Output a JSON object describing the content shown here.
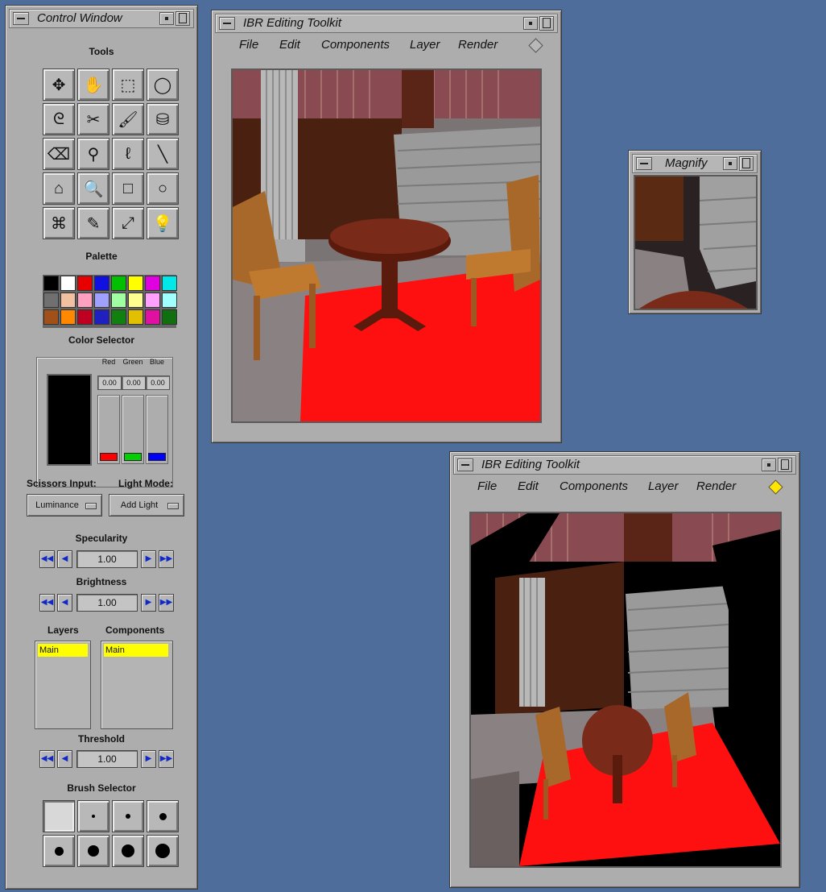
{
  "control_window": {
    "title": "Control Window",
    "sections": {
      "tools": "Tools",
      "palette": "Palette",
      "color_selector": "Color Selector",
      "specularity": "Specularity",
      "brightness": "Brightness",
      "layers": "Layers",
      "components": "Components",
      "threshold": "Threshold",
      "brush_selector": "Brush Selector"
    },
    "tools": [
      {
        "name": "move-tool-icon",
        "glyph": "✥"
      },
      {
        "name": "grab-hand-icon",
        "glyph": "✋"
      },
      {
        "name": "rect-select-icon",
        "glyph": "⬚"
      },
      {
        "name": "ellipse-select-icon",
        "glyph": "◯"
      },
      {
        "name": "lasso-icon",
        "glyph": "ᘓ"
      },
      {
        "name": "scissors-icon",
        "glyph": "✂"
      },
      {
        "name": "paint-brush-icon",
        "glyph": "🖌"
      },
      {
        "name": "bucket-fill-icon",
        "glyph": "⛁"
      },
      {
        "name": "eraser-icon",
        "glyph": "⌫"
      },
      {
        "name": "eyedropper-icon",
        "glyph": "⚲"
      },
      {
        "name": "freeform-icon",
        "glyph": "ℓ"
      },
      {
        "name": "line-tool-icon",
        "glyph": "╲"
      },
      {
        "name": "polygon-icon",
        "glyph": "⌂"
      },
      {
        "name": "magnify-icon",
        "glyph": "🔍"
      },
      {
        "name": "rectangle-tool-icon",
        "glyph": "□"
      },
      {
        "name": "ellipse-outline-icon",
        "glyph": "○"
      },
      {
        "name": "stamp-tool-icon",
        "glyph": "⌘"
      },
      {
        "name": "pencil-icon",
        "glyph": "✎"
      },
      {
        "name": "scale-tool-icon",
        "glyph": "⤢"
      },
      {
        "name": "light-bulb-icon",
        "glyph": "💡"
      }
    ],
    "palette_colors": [
      "#000000",
      "#ffffff",
      "#e80000",
      "#1010e0",
      "#00c000",
      "#ffff00",
      "#e000e0",
      "#00e8e8",
      "#707070",
      "#f0c0a0",
      "#ffa0c0",
      "#a0a0ff",
      "#a0ffa0",
      "#ffff90",
      "#ffa0ff",
      "#a0ffff",
      "#a05018",
      "#ff8800",
      "#c00020",
      "#2020c0",
      "#108010",
      "#e0c000",
      "#e010a0",
      "#107010"
    ],
    "color_selector": {
      "labels": [
        "Red",
        "Green",
        "Blue"
      ],
      "values": [
        "0.00",
        "0.00",
        "0.00"
      ],
      "knob_colors": [
        "#ff0000",
        "#00d000",
        "#0000ff"
      ]
    },
    "scissors_input": {
      "label": "Scissors Input:",
      "value": "Luminance"
    },
    "light_mode": {
      "label": "Light Mode:",
      "value": "Add Light"
    },
    "specularity_value": "1.00",
    "brightness_value": "1.00",
    "threshold_value": "1.00",
    "layers": [
      "Main"
    ],
    "components": [
      "Main"
    ],
    "brushes": [
      0,
      4,
      6,
      9,
      11,
      14,
      16,
      18
    ]
  },
  "editor_top": {
    "title": "IBR Editing Toolkit",
    "menu": [
      "File",
      "Edit",
      "Components",
      "Layer",
      "Render"
    ],
    "indicator_color": "#b8b8b8"
  },
  "editor_bottom": {
    "title": "IBR Editing Toolkit",
    "menu": [
      "File",
      "Edit",
      "Components",
      "Layer",
      "Render"
    ],
    "indicator_color": "#ffe600"
  },
  "magnify": {
    "title": "Magnify"
  }
}
